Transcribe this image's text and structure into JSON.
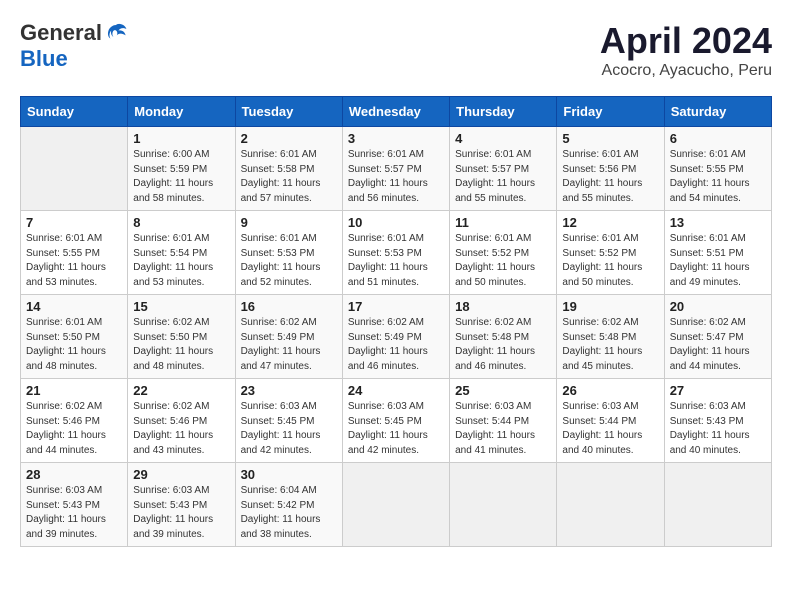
{
  "header": {
    "logo_general": "General",
    "logo_blue": "Blue",
    "month": "April 2024",
    "location": "Acocro, Ayacucho, Peru"
  },
  "weekdays": [
    "Sunday",
    "Monday",
    "Tuesday",
    "Wednesday",
    "Thursday",
    "Friday",
    "Saturday"
  ],
  "weeks": [
    [
      {
        "day": "",
        "info": ""
      },
      {
        "day": "1",
        "info": "Sunrise: 6:00 AM\nSunset: 5:59 PM\nDaylight: 11 hours\nand 58 minutes."
      },
      {
        "day": "2",
        "info": "Sunrise: 6:01 AM\nSunset: 5:58 PM\nDaylight: 11 hours\nand 57 minutes."
      },
      {
        "day": "3",
        "info": "Sunrise: 6:01 AM\nSunset: 5:57 PM\nDaylight: 11 hours\nand 56 minutes."
      },
      {
        "day": "4",
        "info": "Sunrise: 6:01 AM\nSunset: 5:57 PM\nDaylight: 11 hours\nand 55 minutes."
      },
      {
        "day": "5",
        "info": "Sunrise: 6:01 AM\nSunset: 5:56 PM\nDaylight: 11 hours\nand 55 minutes."
      },
      {
        "day": "6",
        "info": "Sunrise: 6:01 AM\nSunset: 5:55 PM\nDaylight: 11 hours\nand 54 minutes."
      }
    ],
    [
      {
        "day": "7",
        "info": "Sunrise: 6:01 AM\nSunset: 5:55 PM\nDaylight: 11 hours\nand 53 minutes."
      },
      {
        "day": "8",
        "info": "Sunrise: 6:01 AM\nSunset: 5:54 PM\nDaylight: 11 hours\nand 53 minutes."
      },
      {
        "day": "9",
        "info": "Sunrise: 6:01 AM\nSunset: 5:53 PM\nDaylight: 11 hours\nand 52 minutes."
      },
      {
        "day": "10",
        "info": "Sunrise: 6:01 AM\nSunset: 5:53 PM\nDaylight: 11 hours\nand 51 minutes."
      },
      {
        "day": "11",
        "info": "Sunrise: 6:01 AM\nSunset: 5:52 PM\nDaylight: 11 hours\nand 50 minutes."
      },
      {
        "day": "12",
        "info": "Sunrise: 6:01 AM\nSunset: 5:52 PM\nDaylight: 11 hours\nand 50 minutes."
      },
      {
        "day": "13",
        "info": "Sunrise: 6:01 AM\nSunset: 5:51 PM\nDaylight: 11 hours\nand 49 minutes."
      }
    ],
    [
      {
        "day": "14",
        "info": "Sunrise: 6:01 AM\nSunset: 5:50 PM\nDaylight: 11 hours\nand 48 minutes."
      },
      {
        "day": "15",
        "info": "Sunrise: 6:02 AM\nSunset: 5:50 PM\nDaylight: 11 hours\nand 48 minutes."
      },
      {
        "day": "16",
        "info": "Sunrise: 6:02 AM\nSunset: 5:49 PM\nDaylight: 11 hours\nand 47 minutes."
      },
      {
        "day": "17",
        "info": "Sunrise: 6:02 AM\nSunset: 5:49 PM\nDaylight: 11 hours\nand 46 minutes."
      },
      {
        "day": "18",
        "info": "Sunrise: 6:02 AM\nSunset: 5:48 PM\nDaylight: 11 hours\nand 46 minutes."
      },
      {
        "day": "19",
        "info": "Sunrise: 6:02 AM\nSunset: 5:48 PM\nDaylight: 11 hours\nand 45 minutes."
      },
      {
        "day": "20",
        "info": "Sunrise: 6:02 AM\nSunset: 5:47 PM\nDaylight: 11 hours\nand 44 minutes."
      }
    ],
    [
      {
        "day": "21",
        "info": "Sunrise: 6:02 AM\nSunset: 5:46 PM\nDaylight: 11 hours\nand 44 minutes."
      },
      {
        "day": "22",
        "info": "Sunrise: 6:02 AM\nSunset: 5:46 PM\nDaylight: 11 hours\nand 43 minutes."
      },
      {
        "day": "23",
        "info": "Sunrise: 6:03 AM\nSunset: 5:45 PM\nDaylight: 11 hours\nand 42 minutes."
      },
      {
        "day": "24",
        "info": "Sunrise: 6:03 AM\nSunset: 5:45 PM\nDaylight: 11 hours\nand 42 minutes."
      },
      {
        "day": "25",
        "info": "Sunrise: 6:03 AM\nSunset: 5:44 PM\nDaylight: 11 hours\nand 41 minutes."
      },
      {
        "day": "26",
        "info": "Sunrise: 6:03 AM\nSunset: 5:44 PM\nDaylight: 11 hours\nand 40 minutes."
      },
      {
        "day": "27",
        "info": "Sunrise: 6:03 AM\nSunset: 5:43 PM\nDaylight: 11 hours\nand 40 minutes."
      }
    ],
    [
      {
        "day": "28",
        "info": "Sunrise: 6:03 AM\nSunset: 5:43 PM\nDaylight: 11 hours\nand 39 minutes."
      },
      {
        "day": "29",
        "info": "Sunrise: 6:03 AM\nSunset: 5:43 PM\nDaylight: 11 hours\nand 39 minutes."
      },
      {
        "day": "30",
        "info": "Sunrise: 6:04 AM\nSunset: 5:42 PM\nDaylight: 11 hours\nand 38 minutes."
      },
      {
        "day": "",
        "info": ""
      },
      {
        "day": "",
        "info": ""
      },
      {
        "day": "",
        "info": ""
      },
      {
        "day": "",
        "info": ""
      }
    ]
  ]
}
